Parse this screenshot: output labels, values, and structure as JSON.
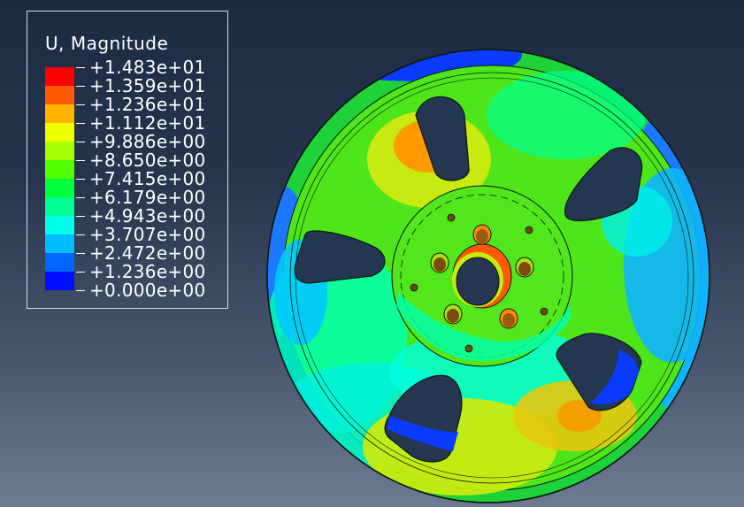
{
  "legend": {
    "title": "U, Magnitude",
    "values": [
      "+1.483e+01",
      "+1.359e+01",
      "+1.236e+01",
      "+1.112e+01",
      "+9.886e+00",
      "+8.650e+00",
      "+7.415e+00",
      "+6.179e+00",
      "+4.943e+00",
      "+3.707e+00",
      "+2.472e+00",
      "+1.236e+00",
      "+0.000e+00"
    ],
    "colors": [
      "#ff0000",
      "#ff5a00",
      "#ffb400",
      "#f0ff00",
      "#a8ff00",
      "#52ff00",
      "#00ff3c",
      "#00ff90",
      "#00ffe8",
      "#00bcff",
      "#0066ff",
      "#0010ff"
    ]
  },
  "model": {
    "palette": {
      "background_top": "#1c2a44",
      "background_bottom": "#6d7c92",
      "rim": "#1fd23a",
      "face": "#4ee61a",
      "hub": "#52e61c",
      "hole": "#243650",
      "blue": "#0a3cff",
      "cyan": "#10f0e4",
      "yellow": "#c8ea10",
      "orange": "#ff7a00"
    }
  }
}
